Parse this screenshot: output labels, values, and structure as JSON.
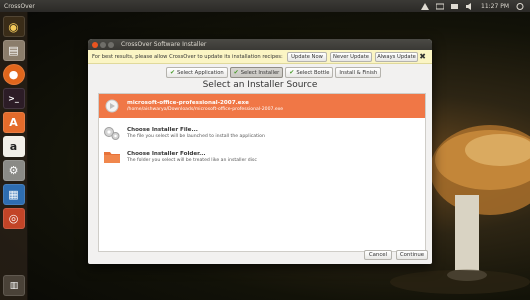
{
  "panel": {
    "app_name": "CrossOver",
    "clock": "11:27 PM"
  },
  "launcher": {
    "items": [
      {
        "name": "ubuntu-dash",
        "glyph": "◉"
      },
      {
        "name": "files",
        "glyph": "▤"
      },
      {
        "name": "firefox",
        "glyph": "●"
      },
      {
        "name": "terminal",
        "glyph": ">_"
      },
      {
        "name": "software-center",
        "glyph": "A"
      },
      {
        "name": "amazon",
        "glyph": "a"
      },
      {
        "name": "settings",
        "glyph": "⚙"
      },
      {
        "name": "writer",
        "glyph": "▦"
      },
      {
        "name": "crossover",
        "glyph": "◎"
      },
      {
        "name": "trash",
        "glyph": "🗑"
      }
    ]
  },
  "dialog": {
    "window_title": "CrossOver Software Installer",
    "notice_message": "For best results, please allow CrossOver to update its installation recipes:",
    "update_now": "Update Now",
    "never_update": "Never Update",
    "always_update": "Always Update",
    "close_notice": "✖",
    "steps": [
      {
        "label": "Select Application",
        "checked": true,
        "active": false
      },
      {
        "label": "Select Installer",
        "checked": true,
        "active": true
      },
      {
        "label": "Select Bottle",
        "checked": true,
        "active": false
      },
      {
        "label": "Install & Finish",
        "checked": false,
        "active": false
      }
    ],
    "heading": "Select an Installer Source",
    "sources": [
      {
        "title": "microsoft-office-professional-2007.exe",
        "subtitle": "/home/aishwarya/Downloads/microsoft-office-professional-2007.exe",
        "icon": "executable-icon",
        "selected": true
      },
      {
        "title": "Choose Installer File...",
        "subtitle": "The file you select will be launched to install the application",
        "icon": "gear-file-icon",
        "selected": false
      },
      {
        "title": "Choose Installer Folder...",
        "subtitle": "The folder you select will be treated like an installer disc",
        "icon": "folder-icon",
        "selected": false
      }
    ],
    "cancel": "Cancel",
    "continue": "Continue"
  },
  "colors": {
    "selection": "#f07746",
    "notice_bg": "#fbf5c4",
    "accent_close": "#e95420"
  }
}
